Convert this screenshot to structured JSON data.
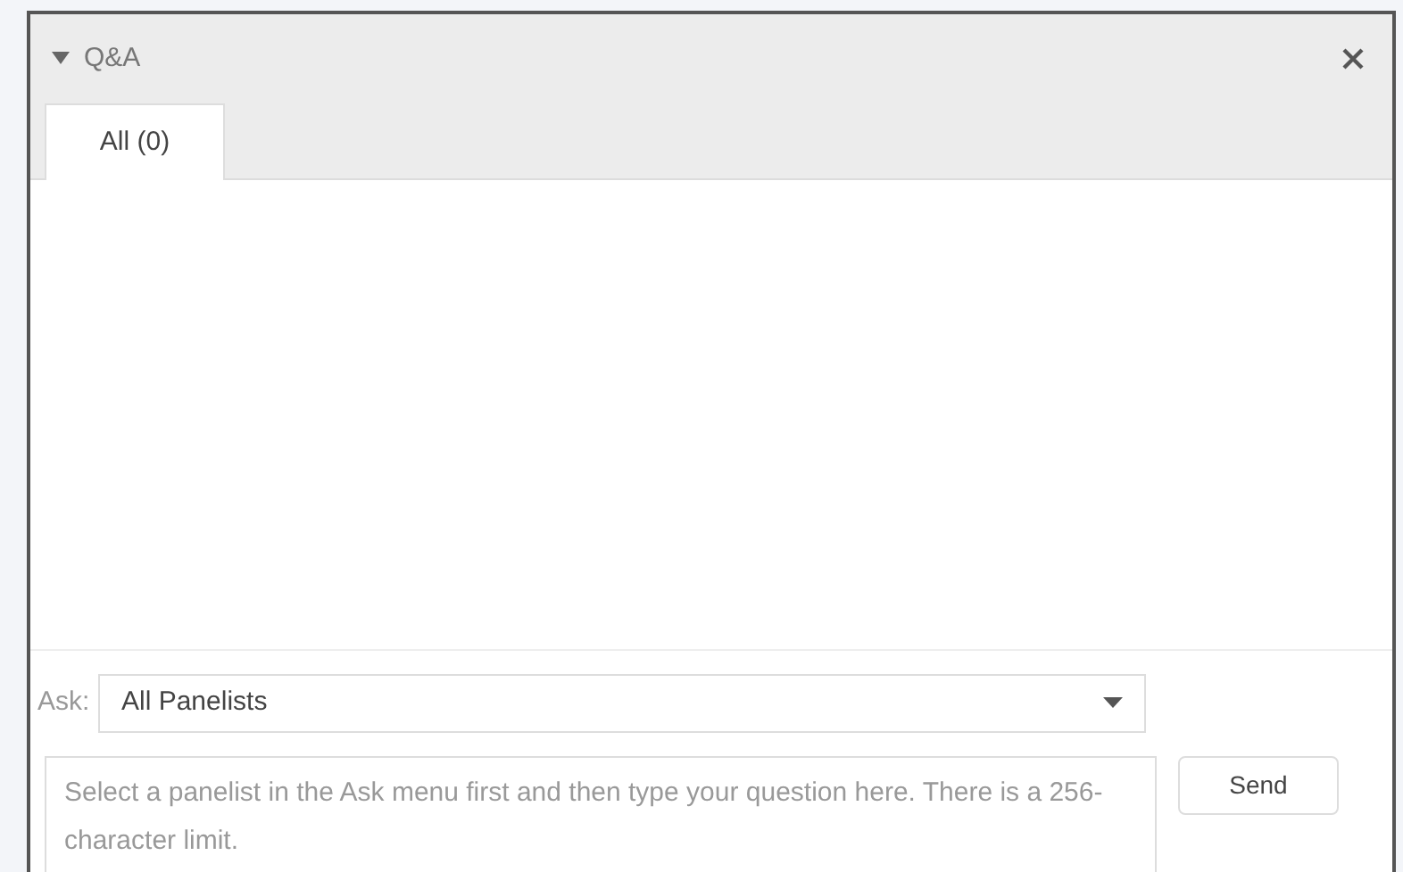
{
  "panel": {
    "title": "Q&A",
    "expanded": true
  },
  "tabs": [
    {
      "label": "All (0)",
      "selected": true
    }
  ],
  "ask": {
    "label": "Ask:",
    "value": "All Panelists"
  },
  "question": {
    "placeholder": "Select a panelist in the Ask menu first and then type your question here. There is a 256-character limit."
  },
  "buttons": [
    "Send"
  ]
}
